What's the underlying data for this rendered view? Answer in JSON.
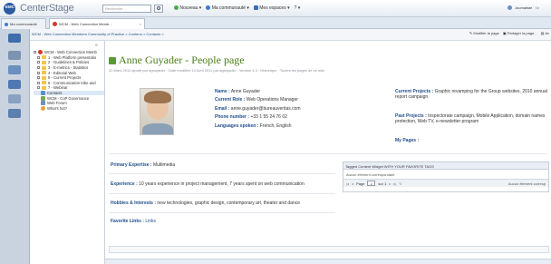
{
  "app": {
    "brand": "EMC",
    "name": "CenterStage",
    "search_placeholder": "Recherche..."
  },
  "topnav": {
    "new_label": "Nouveau",
    "communities_label": "Ma communauté",
    "spaces_label": "Mes espaces",
    "help_label": "?",
    "user_label": "Journaliste",
    "more_label": "Se"
  },
  "tabs": [
    {
      "label": "Ma communauté"
    },
    {
      "label": "WCM - Web Connection Memb..."
    }
  ],
  "breadcrumb": "WCM - Web Connection Members Community of Practice > Contenu > Contacts >",
  "page_actions": [
    {
      "label": "Modifier la page"
    },
    {
      "label": "Partager la page..."
    },
    {
      "label": "Ac"
    }
  ],
  "tree": {
    "items": [
      {
        "label": "WCM - Web Connection Memb"
      },
      {
        "label": "1 - Web Platform presentatio"
      },
      {
        "label": "2 - Guidelines & Policies"
      },
      {
        "label": "3 - E-metrics - Statistics"
      },
      {
        "label": "4 - Editorial Web"
      },
      {
        "label": "5 - Current Projects"
      },
      {
        "label": "6 - Communication tribe and"
      },
      {
        "label": "7 - Webinar"
      },
      {
        "label": "Contacts"
      },
      {
        "label": "WCM - CoP Governance"
      },
      {
        "label": "Web Forum"
      },
      {
        "label": "What's hot?"
      }
    ]
  },
  "page": {
    "title": "Anne Guyader - People page",
    "meta": "31 Mars 2011 ajouté par agruyader · Date modifiée 14 Avril 2011 par agruyader · Version 1.3 · Historique · Toutes les pages de ce wiki",
    "fields": [
      {
        "label": "Name :",
        "value": "Anne Guyader"
      },
      {
        "label": "Current Role :",
        "value": "Web Operations Manager"
      },
      {
        "label": "Email :",
        "value": "anne.guyader@bureauveritas.com"
      },
      {
        "label": "Phone number :",
        "value": "+33 1 55 24 76 02"
      },
      {
        "label": "Languages spoken :",
        "value": "French, English"
      }
    ],
    "current_projects_label": "Current Projects :",
    "current_projects_value": "Graphic revamping for the Group websites, 2010 annual report campaign",
    "past_projects_label": "Past Projects :",
    "past_projects_value": "Inspectorate campaign, Mobile Application, domain names protection, Web TV, e-newsletter program",
    "my_pages_label": "My Pages :",
    "primary_expertise_label": "Primary Expertise :",
    "primary_expertise_value": "Multimedia",
    "experience_label": "Experience :",
    "experience_value": "10 years experience in project management, 7 years spent on web communication",
    "hobbies_label": "Hobbies & Interests :",
    "hobbies_value": "new technologies, graphic design, contemporary art, theater and dance",
    "links_label": "Favorite Links :",
    "links_value": "Links"
  },
  "widget": {
    "title": "Tagged Content Widget WITH YOUR FAVORITE TAGS",
    "empty": "Aucun élément correspondant",
    "page_label": "Page",
    "page_value": "1",
    "of_label": "sur 1",
    "no_items": "Aucun élément corresp"
  },
  "colors": {
    "accent": "#1f4e8c",
    "title_green": "#4a7f1a",
    "rail": "#c9d3df"
  }
}
